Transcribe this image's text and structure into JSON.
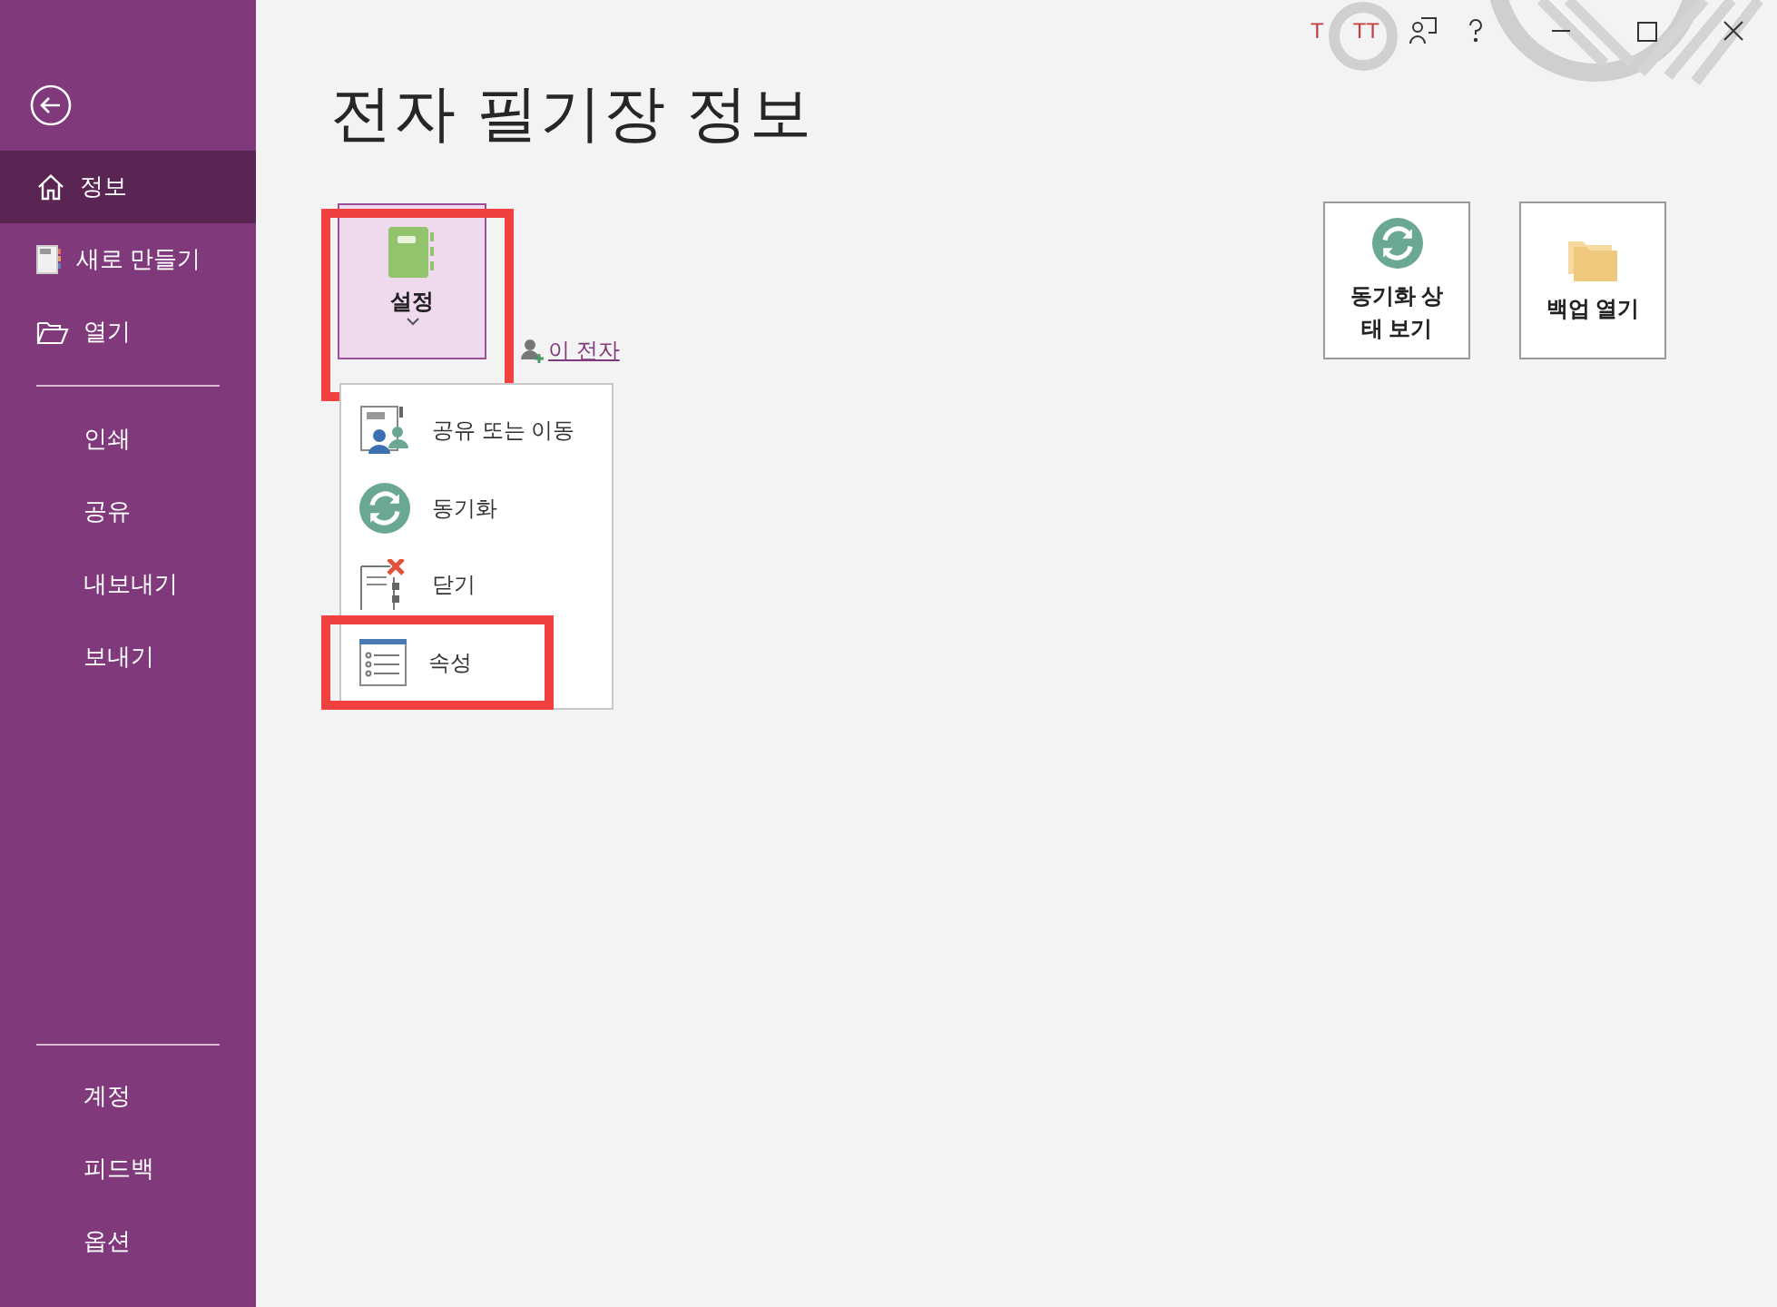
{
  "title_bar": {
    "texts": [
      "T",
      "TT"
    ]
  },
  "sidebar": {
    "top_items": [
      {
        "label": "정보",
        "selected": true
      },
      {
        "label": "새로 만들기",
        "selected": false
      },
      {
        "label": "열기",
        "selected": false
      }
    ],
    "middle_items": [
      {
        "label": "인쇄",
        "selected": false
      },
      {
        "label": "공유",
        "selected": false
      },
      {
        "label": "내보내기",
        "selected": false
      },
      {
        "label": "보내기",
        "selected": false
      }
    ],
    "bottom_items": [
      {
        "label": "계정",
        "selected": false
      },
      {
        "label": "피드백",
        "selected": false
      },
      {
        "label": "옵션",
        "selected": false
      }
    ]
  },
  "page_title": "전자 필기장 정보",
  "settings_button": {
    "label": "설정",
    "highlighted": true
  },
  "share_link": "이 전자",
  "settings_menu": [
    {
      "label": "공유 또는 이동",
      "highlighted": false
    },
    {
      "label": "동기화",
      "highlighted": false
    },
    {
      "label": "닫기",
      "highlighted": false
    },
    {
      "label": "속성",
      "highlighted": true
    }
  ],
  "actions": [
    {
      "label": "동기화 상\n태 보기"
    },
    {
      "label": "백업 열기"
    }
  ]
}
